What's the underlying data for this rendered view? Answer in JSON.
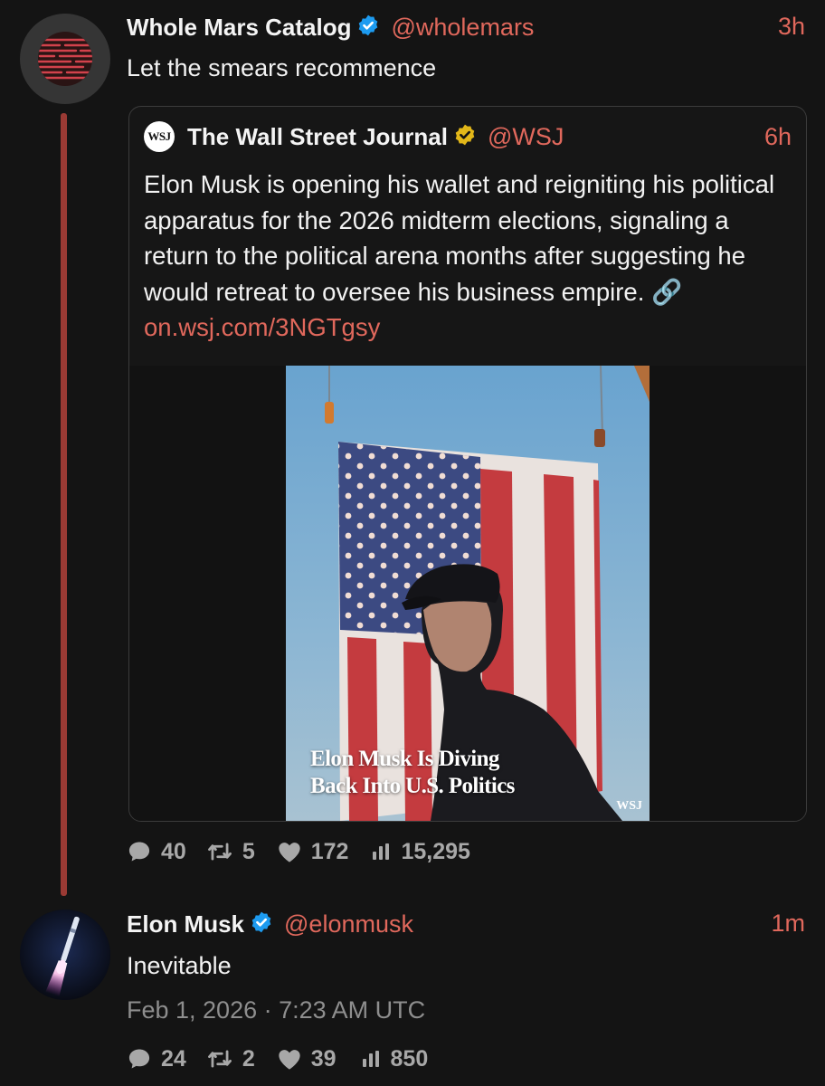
{
  "tweet": {
    "author_name": "Whole Mars Catalog",
    "handle": "@wholemars",
    "time": "3h",
    "text": "Let the smears recommence",
    "quote": {
      "logo_text": "WSJ",
      "author_name": "The Wall Street Journal",
      "handle": "@WSJ",
      "time": "6h",
      "text": "Elon Musk is opening his wallet and reigniting his political apparatus for the 2026 midterm elections, signaling a return to the political arena months after suggesting he would retreat to oversee his business empire.",
      "link_icon": "🔗",
      "link": "on.wsj.com/3NGTgsy",
      "media": {
        "headline_line1": "Elon Musk Is Diving",
        "headline_line2": "Back Into U.S. Politics",
        "watermark": "WSJ"
      }
    },
    "stats": {
      "replies": "40",
      "retweets": "5",
      "likes": "172",
      "views": "15,295"
    }
  },
  "reply": {
    "author_name": "Elon Musk",
    "handle": "@elonmusk",
    "time": "1m",
    "text": "Inevitable",
    "date": "Feb 1, 2026 · 7:23 AM UTC",
    "stats": {
      "replies": "24",
      "retweets": "2",
      "likes": "39",
      "views": "850"
    }
  },
  "icons": {
    "verified": "verified-badge-blue",
    "verified_gold": "verified-badge-gold",
    "reply": "comment-icon",
    "retweet": "retweet-icon",
    "like": "heart-icon",
    "views": "bar-chart-icon",
    "link": "link-icon"
  },
  "colors": {
    "accent": "#e0685c",
    "verified_blue": "#1d9bf0",
    "verified_gold": "#e2b719",
    "background": "#141414",
    "thread_line": "#9a3a34"
  }
}
